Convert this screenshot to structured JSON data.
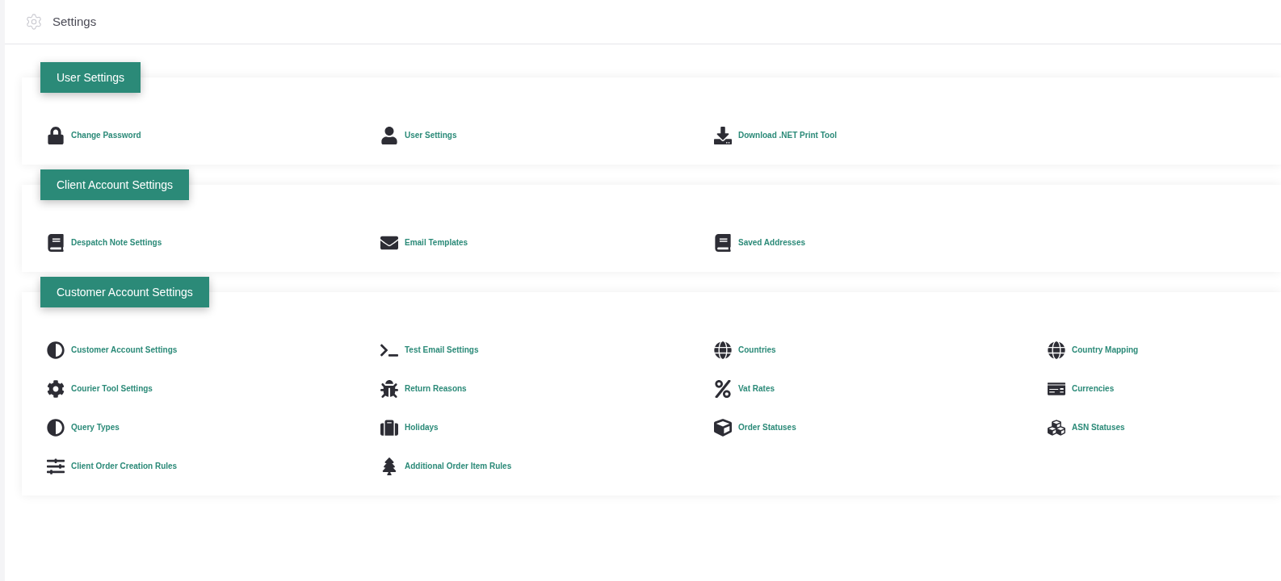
{
  "header": {
    "title": "Settings"
  },
  "sections": [
    {
      "title": "User Settings",
      "items": [
        "Change Password",
        "User Settings",
        "Download .NET Print Tool"
      ]
    },
    {
      "title": "Client Account Settings",
      "items": [
        "Despatch Note Settings",
        "Email Templates",
        "Saved Addresses"
      ]
    },
    {
      "title": "Customer Account Settings",
      "items": [
        "Customer Account Settings",
        "Test Email Settings",
        "Countries",
        "Country Mapping",
        "Courier Tool Settings",
        "Return Reasons",
        "Vat Rates",
        "Currencies",
        "Query Types",
        "Holidays",
        "Order Statuses",
        "ASN Statuses",
        "Client Order Creation Rules",
        "Additional Order Item Rules"
      ]
    }
  ]
}
